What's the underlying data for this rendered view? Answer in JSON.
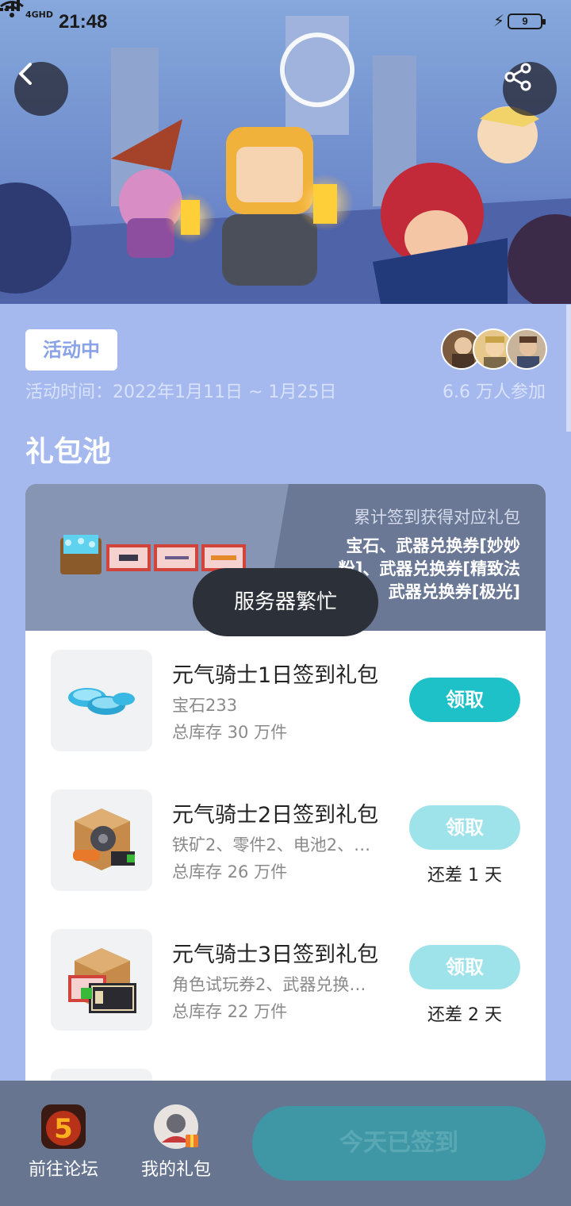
{
  "status_bar": {
    "network": "4GHD",
    "time": "21:48",
    "battery": "9"
  },
  "activity": {
    "status_badge": "活动中",
    "time_label": "活动时间：2022年1月11日 ~ 1月25日",
    "participants": "6.6 万人参加"
  },
  "section_title": "礼包池",
  "pool": {
    "desc_title": "累计签到获得对应礼包",
    "desc_lines": [
      "宝石、武器兑换券[妙妙",
      "粉]、武器兑换券[精致法",
      "杖]、武器兑换券[极光]"
    ]
  },
  "toast": "服务器繁忙",
  "gifts": [
    {
      "name": "元气骑士1日签到礼包",
      "desc": "宝石233",
      "stock": "总库存 30 万件",
      "button": "领取",
      "days_left": ""
    },
    {
      "name": "元气骑士2日签到礼包",
      "desc": "铁矿2、零件2、电池2、…",
      "stock": "总库存 26 万件",
      "button": "领取",
      "days_left": "还差 1 天"
    },
    {
      "name": "元气骑士3日签到礼包",
      "desc": "角色试玩券2、武器兑换…",
      "stock": "总库存 22 万件",
      "button": "领取",
      "days_left": "还差 2 天"
    }
  ],
  "bottom_bar": {
    "forum_label": "前往论坛",
    "my_gifts_label": "我的礼包",
    "sign_button": "今天已签到"
  },
  "colors": {
    "page_bg": "#a6b9ef",
    "accent_teal": "#1fc1c9",
    "bottom_bar": "#677591"
  }
}
